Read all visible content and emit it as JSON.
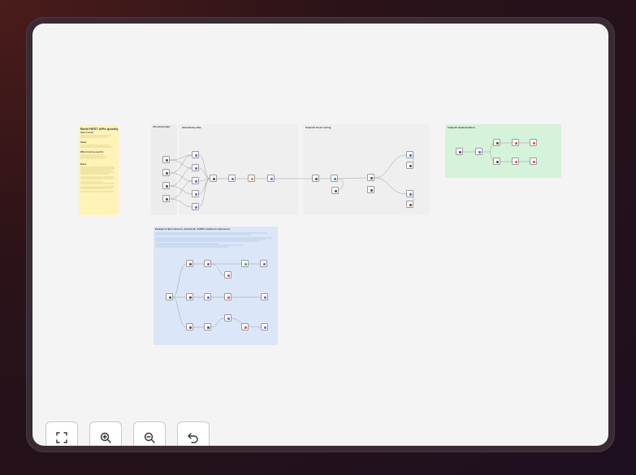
{
  "sticky_notes": {
    "main": {
      "title": "Build REST APIs quickly",
      "h_how": "How it works",
      "h_setup": "Setup",
      "h_use": "What it can be used for",
      "h_notes": "Notes"
    },
    "api_routing": {
      "title": "API routing header"
    },
    "streamlining": {
      "title": "Streamlining data"
    },
    "endpoint_routing": {
      "title": "Endpoint based routing"
    },
    "endpoint_impl": {
      "title": "Endpoint implementation"
    },
    "example": {
      "title": "Example for $json based vs. absolute $('_SCREF') notation for data access"
    }
  },
  "controls": {
    "fit_view": "fit-view",
    "zoom_in": "zoom-in",
    "zoom_out": "zoom-out",
    "undo": "undo"
  },
  "colors": {
    "sticky_yellow": "#fff5c2",
    "sticky_gray": "#ececec",
    "sticky_green": "#d9f5de",
    "sticky_blue": "#dbe8fa",
    "node_accent": "#7b5cff"
  }
}
